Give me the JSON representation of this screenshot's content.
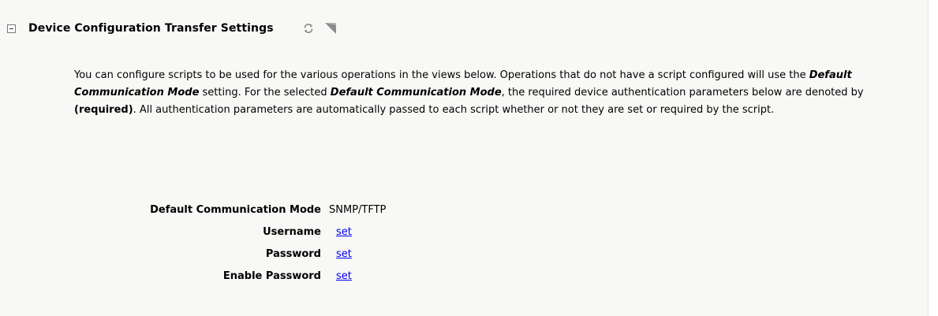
{
  "section": {
    "title": "Device Configuration Transfer Settings",
    "refresh_icon": "refresh-icon",
    "help_icon": "help-icon",
    "collapse_icon": "collapse-icon"
  },
  "description": {
    "part1": "You can configure scripts to be used for the various operations in the views below. Operations that do not have a script configured will use the ",
    "em1": "Default Communication Mode",
    "part2": " setting. For the selected ",
    "em2": "Default Communication Mode",
    "part3": ", the required device authentication parameters below are denoted by ",
    "required": "(required)",
    "part4": ". All authentication parameters are automatically passed to each script whether or not they are set or required by the script."
  },
  "fields": {
    "default_mode": {
      "label": "Default Communication Mode",
      "value": "SNMP/TFTP"
    },
    "username": {
      "label": "Username",
      "link": "set"
    },
    "password": {
      "label": "Password",
      "link": "set"
    },
    "enable_password": {
      "label": "Enable Password",
      "link": "set"
    }
  },
  "colors": {
    "link": "#0000ee",
    "panel_background": "#f8f8f6"
  }
}
